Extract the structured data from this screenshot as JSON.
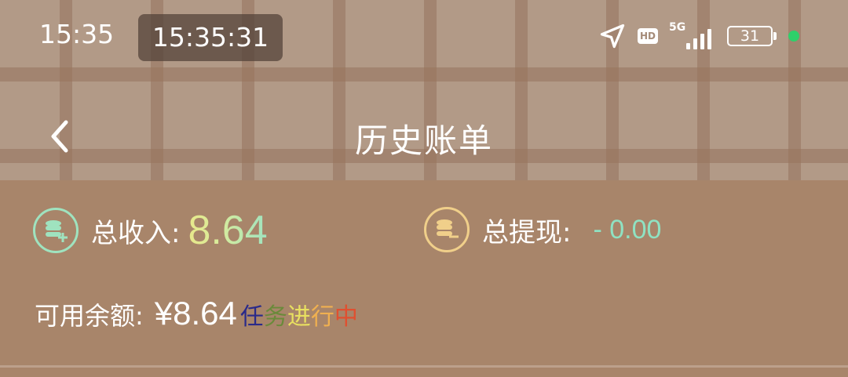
{
  "status_bar": {
    "time": "15:35",
    "clock_chip": "15:35:31",
    "network": "5G",
    "hd": "HD",
    "battery": "31",
    "icons": [
      "location-arrow-icon",
      "hd-icon",
      "signal-5g-icon",
      "battery-icon"
    ]
  },
  "header": {
    "back_icon": "chevron-left-icon",
    "title": "历史账单"
  },
  "summary": {
    "income_label": "总收入:",
    "income_value": "8.64",
    "income_icon": "coin-stack-plus-icon",
    "withdraw_label": "总提现:",
    "withdraw_value": "- 0.00",
    "withdraw_icon": "coin-stack-minus-icon",
    "balance_label": "可用余额:",
    "balance_value": "¥8.64",
    "task_status": [
      "任",
      "务",
      "进",
      "行",
      "中"
    ],
    "task_status_colors": [
      "#2a2a8a",
      "#6a8a3a",
      "#e8e060",
      "#f0b050",
      "#e05030"
    ]
  },
  "colors": {
    "background": "#a8856a",
    "income_icon": "#9fe3bf",
    "withdraw_icon": "#f0cf8a",
    "withdraw_value": "#8fe2c2"
  }
}
